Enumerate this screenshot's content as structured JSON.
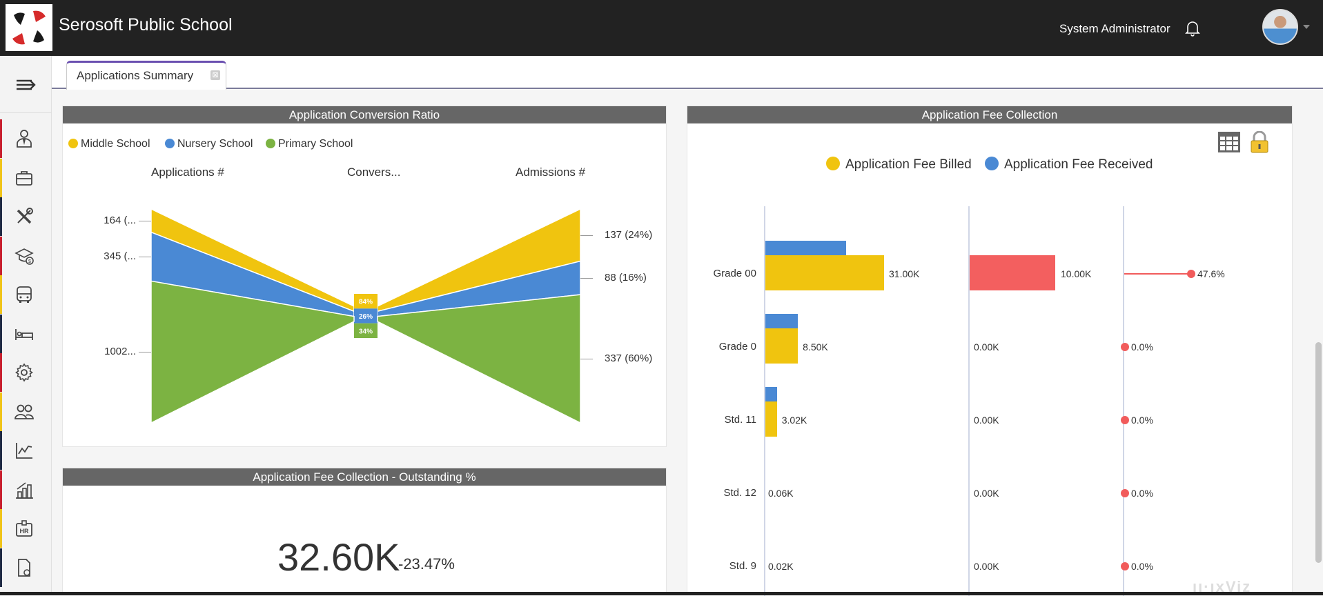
{
  "header": {
    "app_title": "Serosoft Public School",
    "user_name": "System Administrator",
    "icons": [
      "logo",
      "bell-icon",
      "avatar",
      "chevron-down-icon"
    ]
  },
  "sidebar": {
    "toggle_icon": "menu-expand-icon",
    "items": [
      {
        "icon": "staff-icon",
        "accent": "#c8202f"
      },
      {
        "icon": "briefcase-icon",
        "accent": "#f0c419"
      },
      {
        "icon": "tools-icon",
        "accent": "#1f2a44"
      },
      {
        "icon": "graduation-fee-icon",
        "accent": "#c8202f"
      },
      {
        "icon": "bus-icon",
        "accent": "#f0c419"
      },
      {
        "icon": "bed-icon",
        "accent": "#1f2a44"
      },
      {
        "icon": "gear-icon",
        "accent": "#c8202f"
      },
      {
        "icon": "users-icon",
        "accent": "#f0c419"
      },
      {
        "icon": "line-chart-icon",
        "accent": "#1f2a44"
      },
      {
        "icon": "bar-chart-icon",
        "accent": "#c8202f"
      },
      {
        "icon": "hr-badge-icon",
        "accent": "#f0c419"
      },
      {
        "icon": "document-settings-icon",
        "accent": "#1f2a44"
      }
    ]
  },
  "tabs": [
    {
      "label": "Applications Summary",
      "close": "⊠",
      "active": true
    }
  ],
  "conversion_panel": {
    "title": "Application Conversion Ratio"
  },
  "outstanding_panel": {
    "title": "Application Fee Collection - Outstanding %",
    "value": "32.60K",
    "delta": "-23.47%"
  },
  "fee_panel": {
    "title": "Application Fee Collection",
    "icons": [
      "table-icon",
      "lock-icon"
    ]
  },
  "colors": {
    "middle": "#f0c40f",
    "nursery": "#4a89d4",
    "primary": "#7cb342",
    "outstanding": "#f35f5f"
  },
  "chart_data": [
    {
      "type": "funnel",
      "title": "Application Conversion Ratio",
      "legend": [
        "Middle School",
        "Nursery School",
        "Primary School"
      ],
      "columns": [
        "Applications #",
        "Convers...",
        "Admissions #"
      ],
      "series": [
        {
          "name": "Middle School",
          "applications": 164,
          "applications_label": "164 (...",
          "conversion": "84%",
          "admissions": 137,
          "admissions_label": "137 (24%)"
        },
        {
          "name": "Nursery School",
          "applications": 345,
          "applications_label": "345 (...",
          "conversion": "26%",
          "admissions": 88,
          "admissions_label": "88 (16%)"
        },
        {
          "name": "Primary School",
          "applications": 1002,
          "applications_label": "1002...",
          "conversion": "34%",
          "admissions": 337,
          "admissions_label": "337 (60%)"
        }
      ]
    },
    {
      "type": "bar",
      "title": "Application Fee Collection",
      "legend": [
        "Application Fee Billed",
        "Application Fee Received"
      ],
      "legend_position": "top",
      "categories": [
        "Grade 00",
        "Grade 0",
        "Std. 11",
        "Std. 12",
        "Std. 9"
      ],
      "series": [
        {
          "name": "Application Fee Billed",
          "values": [
            31.0,
            8.5,
            3.02,
            0.06,
            0.02
          ],
          "labels": [
            "31.00K",
            "8.50K",
            "3.02K",
            "0.06K",
            "0.02K"
          ]
        },
        {
          "name": "Application Fee Received",
          "values": [
            21.0,
            8.5,
            3.0,
            0.0,
            0.0
          ]
        },
        {
          "name": "Outstanding",
          "values": [
            10.0,
            0,
            0,
            0,
            0
          ],
          "labels": [
            "10.00K",
            "0.00K",
            "0.00K",
            "0.00K",
            "0.00K"
          ]
        },
        {
          "name": "Outstanding %",
          "values": [
            47.6,
            0,
            0,
            0,
            0
          ],
          "labels": [
            "47.6%",
            "0.0%",
            "0.0%",
            "0.0%",
            "0.0%"
          ]
        }
      ],
      "units": "K"
    }
  ]
}
